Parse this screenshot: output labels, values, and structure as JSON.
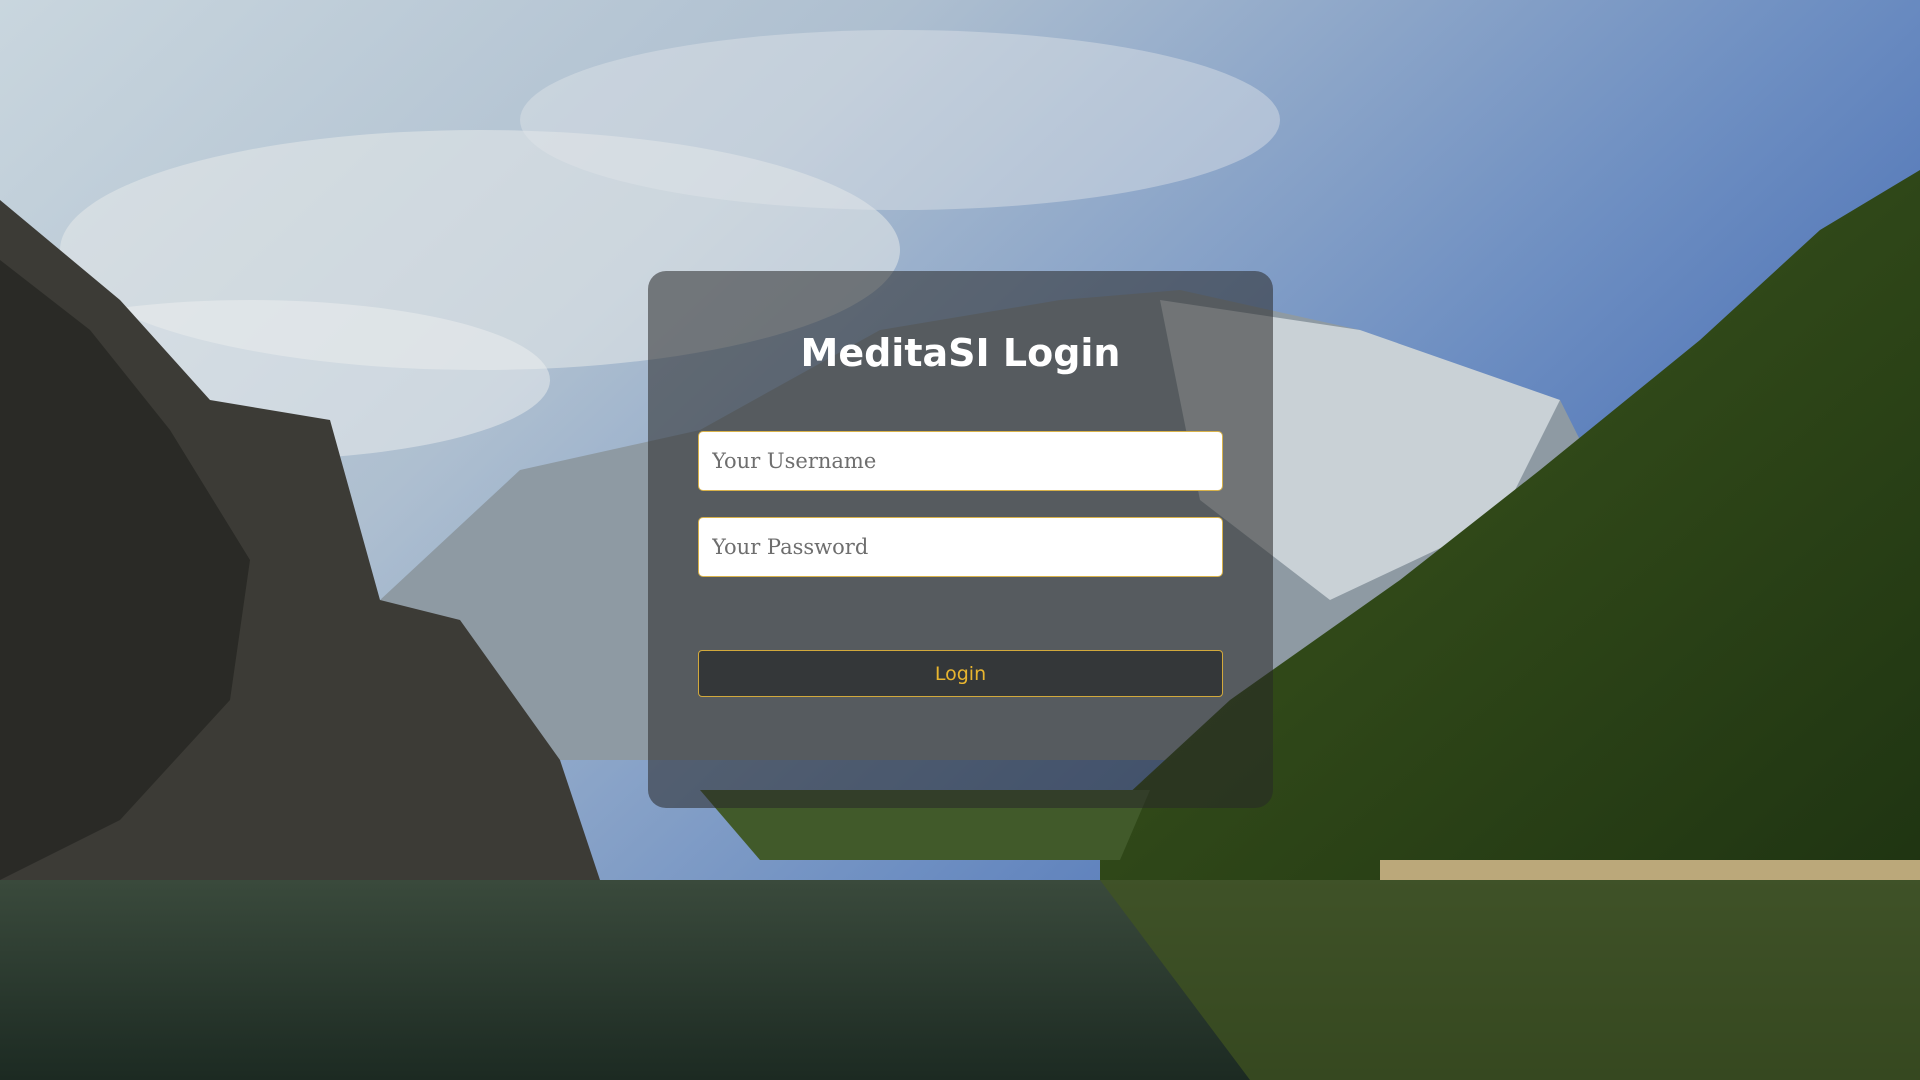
{
  "page": {
    "title": "MeditaSI Login"
  },
  "login_form": {
    "username": {
      "placeholder": "Your Username",
      "value": ""
    },
    "password": {
      "placeholder": "Your Password",
      "value": ""
    },
    "submit_label": "Login"
  },
  "colors": {
    "accent": "#e8b52f",
    "field_border": "#d8b24a",
    "card_background": "rgba(40,40,40,0.55)"
  }
}
